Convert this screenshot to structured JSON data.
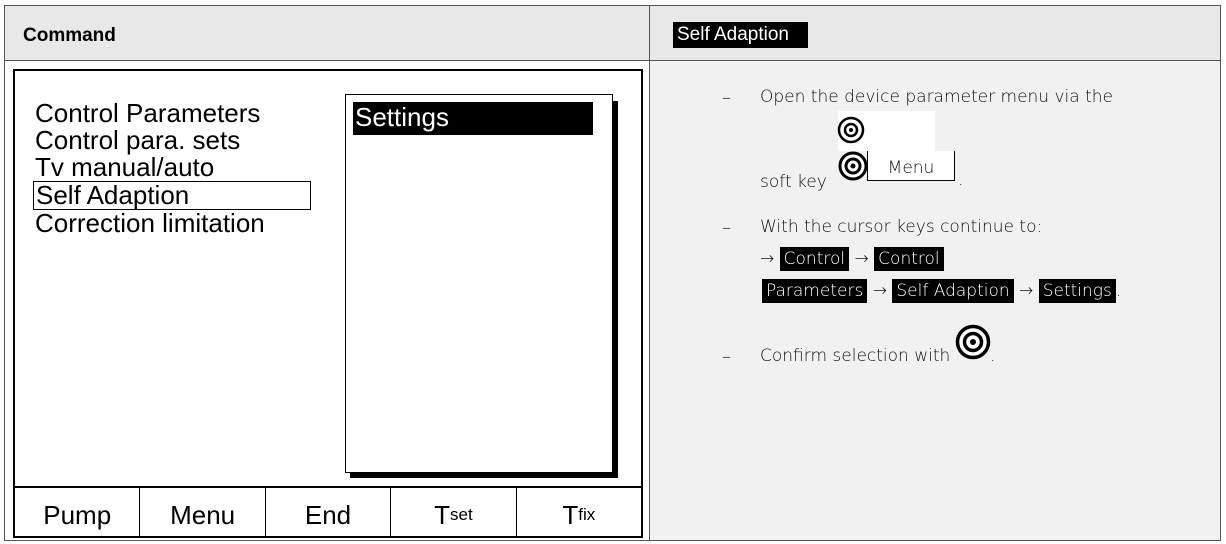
{
  "header": {
    "left_title": "Command",
    "right_title": "Self Adaption"
  },
  "display": {
    "menu_items": [
      "Control Parameters",
      "Control para. sets",
      "Tv manual/auto",
      "Self Adaption",
      "Correction limitation"
    ],
    "selected_menu_item": "Self Adaption",
    "submenu_items": [
      "Settings"
    ],
    "softkeys": [
      {
        "label": "Pump",
        "sub": ""
      },
      {
        "label": "Menu",
        "sub": ""
      },
      {
        "label": "End",
        "sub": ""
      },
      {
        "label": "T",
        "sub": "set"
      },
      {
        "label": "T",
        "sub": "fix"
      }
    ]
  },
  "instructions": {
    "step1_line1": "Open the device parameter menu via the",
    "step1_line2_prefix": "soft key",
    "step1_menu_key": "Menu",
    "step1_period": ".",
    "step2_line1": "With the cursor keys continue to:",
    "step2_arrow": "→",
    "step2_path": [
      "Control",
      "Control",
      "Parameters",
      "Self Adaption",
      "Settings"
    ],
    "step2_period": ".",
    "step3_text": "Confirm selection with",
    "step3_period": ".",
    "dash": "–"
  },
  "icons": {
    "knob": "rotary-knob-icon"
  }
}
